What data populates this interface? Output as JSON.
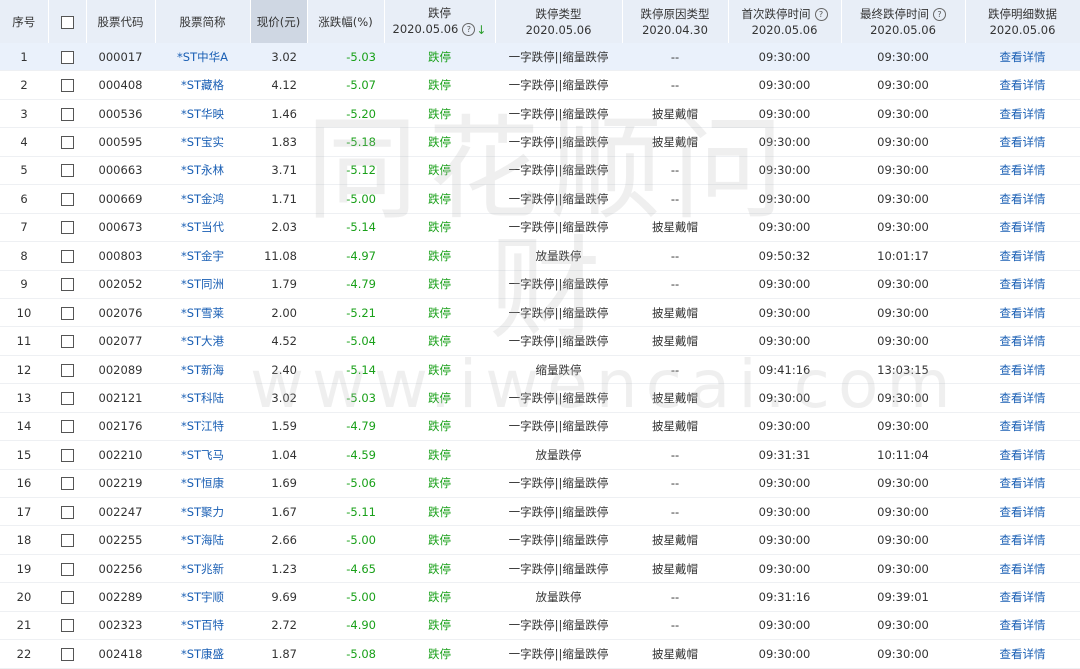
{
  "header": {
    "seq": "序号",
    "code": "股票代码",
    "name": "股票简称",
    "price": "现价(元)",
    "change": "涨跌幅(%)",
    "limit_down": "跌停",
    "limit_down_date": "2020.05.06",
    "limit_type": "跌停类型",
    "limit_type_date": "2020.05.06",
    "reason": "跌停原因类型",
    "reason_date": "2020.04.30",
    "first_time": "首次跌停时间",
    "first_time_date": "2020.05.06",
    "last_time": "最终跌停时间",
    "last_time_date": "2020.05.06",
    "detail": "跌停明细数据",
    "detail_date": "2020.05.06",
    "help_glyph": "?",
    "sort_glyph": "↓"
  },
  "watermark": {
    "line1": "同花顺问财",
    "line2": "www.iwencai.com"
  },
  "rows": [
    {
      "seq": "1",
      "code": "000017",
      "name": "*ST中华A",
      "price": "3.02",
      "change": "-5.03",
      "limit": "跌停",
      "type": "一字跌停||缩量跌停",
      "reason": "--",
      "first": "09:30:00",
      "last": "09:30:00",
      "detail": "查看详情"
    },
    {
      "seq": "2",
      "code": "000408",
      "name": "*ST藏格",
      "price": "4.12",
      "change": "-5.07",
      "limit": "跌停",
      "type": "一字跌停||缩量跌停",
      "reason": "--",
      "first": "09:30:00",
      "last": "09:30:00",
      "detail": "查看详情"
    },
    {
      "seq": "3",
      "code": "000536",
      "name": "*ST华映",
      "price": "1.46",
      "change": "-5.20",
      "limit": "跌停",
      "type": "一字跌停||缩量跌停",
      "reason": "披星戴帽",
      "first": "09:30:00",
      "last": "09:30:00",
      "detail": "查看详情"
    },
    {
      "seq": "4",
      "code": "000595",
      "name": "*ST宝实",
      "price": "1.83",
      "change": "-5.18",
      "limit": "跌停",
      "type": "一字跌停||缩量跌停",
      "reason": "披星戴帽",
      "first": "09:30:00",
      "last": "09:30:00",
      "detail": "查看详情"
    },
    {
      "seq": "5",
      "code": "000663",
      "name": "*ST永林",
      "price": "3.71",
      "change": "-5.12",
      "limit": "跌停",
      "type": "一字跌停||缩量跌停",
      "reason": "--",
      "first": "09:30:00",
      "last": "09:30:00",
      "detail": "查看详情"
    },
    {
      "seq": "6",
      "code": "000669",
      "name": "*ST金鸿",
      "price": "1.71",
      "change": "-5.00",
      "limit": "跌停",
      "type": "一字跌停||缩量跌停",
      "reason": "--",
      "first": "09:30:00",
      "last": "09:30:00",
      "detail": "查看详情"
    },
    {
      "seq": "7",
      "code": "000673",
      "name": "*ST当代",
      "price": "2.03",
      "change": "-5.14",
      "limit": "跌停",
      "type": "一字跌停||缩量跌停",
      "reason": "披星戴帽",
      "first": "09:30:00",
      "last": "09:30:00",
      "detail": "查看详情"
    },
    {
      "seq": "8",
      "code": "000803",
      "name": "*ST金宇",
      "price": "11.08",
      "change": "-4.97",
      "limit": "跌停",
      "type": "放量跌停",
      "reason": "--",
      "first": "09:50:32",
      "last": "10:01:17",
      "detail": "查看详情"
    },
    {
      "seq": "9",
      "code": "002052",
      "name": "*ST同洲",
      "price": "1.79",
      "change": "-4.79",
      "limit": "跌停",
      "type": "一字跌停||缩量跌停",
      "reason": "--",
      "first": "09:30:00",
      "last": "09:30:00",
      "detail": "查看详情"
    },
    {
      "seq": "10",
      "code": "002076",
      "name": "*ST雪莱",
      "price": "2.00",
      "change": "-5.21",
      "limit": "跌停",
      "type": "一字跌停||缩量跌停",
      "reason": "披星戴帽",
      "first": "09:30:00",
      "last": "09:30:00",
      "detail": "查看详情"
    },
    {
      "seq": "11",
      "code": "002077",
      "name": "*ST大港",
      "price": "4.52",
      "change": "-5.04",
      "limit": "跌停",
      "type": "一字跌停||缩量跌停",
      "reason": "披星戴帽",
      "first": "09:30:00",
      "last": "09:30:00",
      "detail": "查看详情"
    },
    {
      "seq": "12",
      "code": "002089",
      "name": "*ST新海",
      "price": "2.40",
      "change": "-5.14",
      "limit": "跌停",
      "type": "缩量跌停",
      "reason": "--",
      "first": "09:41:16",
      "last": "13:03:15",
      "detail": "查看详情"
    },
    {
      "seq": "13",
      "code": "002121",
      "name": "*ST科陆",
      "price": "3.02",
      "change": "-5.03",
      "limit": "跌停",
      "type": "一字跌停||缩量跌停",
      "reason": "披星戴帽",
      "first": "09:30:00",
      "last": "09:30:00",
      "detail": "查看详情"
    },
    {
      "seq": "14",
      "code": "002176",
      "name": "*ST江特",
      "price": "1.59",
      "change": "-4.79",
      "limit": "跌停",
      "type": "一字跌停||缩量跌停",
      "reason": "披星戴帽",
      "first": "09:30:00",
      "last": "09:30:00",
      "detail": "查看详情"
    },
    {
      "seq": "15",
      "code": "002210",
      "name": "*ST飞马",
      "price": "1.04",
      "change": "-4.59",
      "limit": "跌停",
      "type": "放量跌停",
      "reason": "--",
      "first": "09:31:31",
      "last": "10:11:04",
      "detail": "查看详情"
    },
    {
      "seq": "16",
      "code": "002219",
      "name": "*ST恒康",
      "price": "1.69",
      "change": "-5.06",
      "limit": "跌停",
      "type": "一字跌停||缩量跌停",
      "reason": "--",
      "first": "09:30:00",
      "last": "09:30:00",
      "detail": "查看详情"
    },
    {
      "seq": "17",
      "code": "002247",
      "name": "*ST聚力",
      "price": "1.67",
      "change": "-5.11",
      "limit": "跌停",
      "type": "一字跌停||缩量跌停",
      "reason": "--",
      "first": "09:30:00",
      "last": "09:30:00",
      "detail": "查看详情"
    },
    {
      "seq": "18",
      "code": "002255",
      "name": "*ST海陆",
      "price": "2.66",
      "change": "-5.00",
      "limit": "跌停",
      "type": "一字跌停||缩量跌停",
      "reason": "披星戴帽",
      "first": "09:30:00",
      "last": "09:30:00",
      "detail": "查看详情"
    },
    {
      "seq": "19",
      "code": "002256",
      "name": "*ST兆新",
      "price": "1.23",
      "change": "-4.65",
      "limit": "跌停",
      "type": "一字跌停||缩量跌停",
      "reason": "披星戴帽",
      "first": "09:30:00",
      "last": "09:30:00",
      "detail": "查看详情"
    },
    {
      "seq": "20",
      "code": "002289",
      "name": "*ST宇顺",
      "price": "9.69",
      "change": "-5.00",
      "limit": "跌停",
      "type": "放量跌停",
      "reason": "--",
      "first": "09:31:16",
      "last": "09:39:01",
      "detail": "查看详情"
    },
    {
      "seq": "21",
      "code": "002323",
      "name": "*ST百特",
      "price": "2.72",
      "change": "-4.90",
      "limit": "跌停",
      "type": "一字跌停||缩量跌停",
      "reason": "--",
      "first": "09:30:00",
      "last": "09:30:00",
      "detail": "查看详情"
    },
    {
      "seq": "22",
      "code": "002418",
      "name": "*ST康盛",
      "price": "1.87",
      "change": "-5.08",
      "limit": "跌停",
      "type": "一字跌停||缩量跌停",
      "reason": "披星戴帽",
      "first": "09:30:00",
      "last": "09:30:00",
      "detail": "查看详情"
    }
  ]
}
